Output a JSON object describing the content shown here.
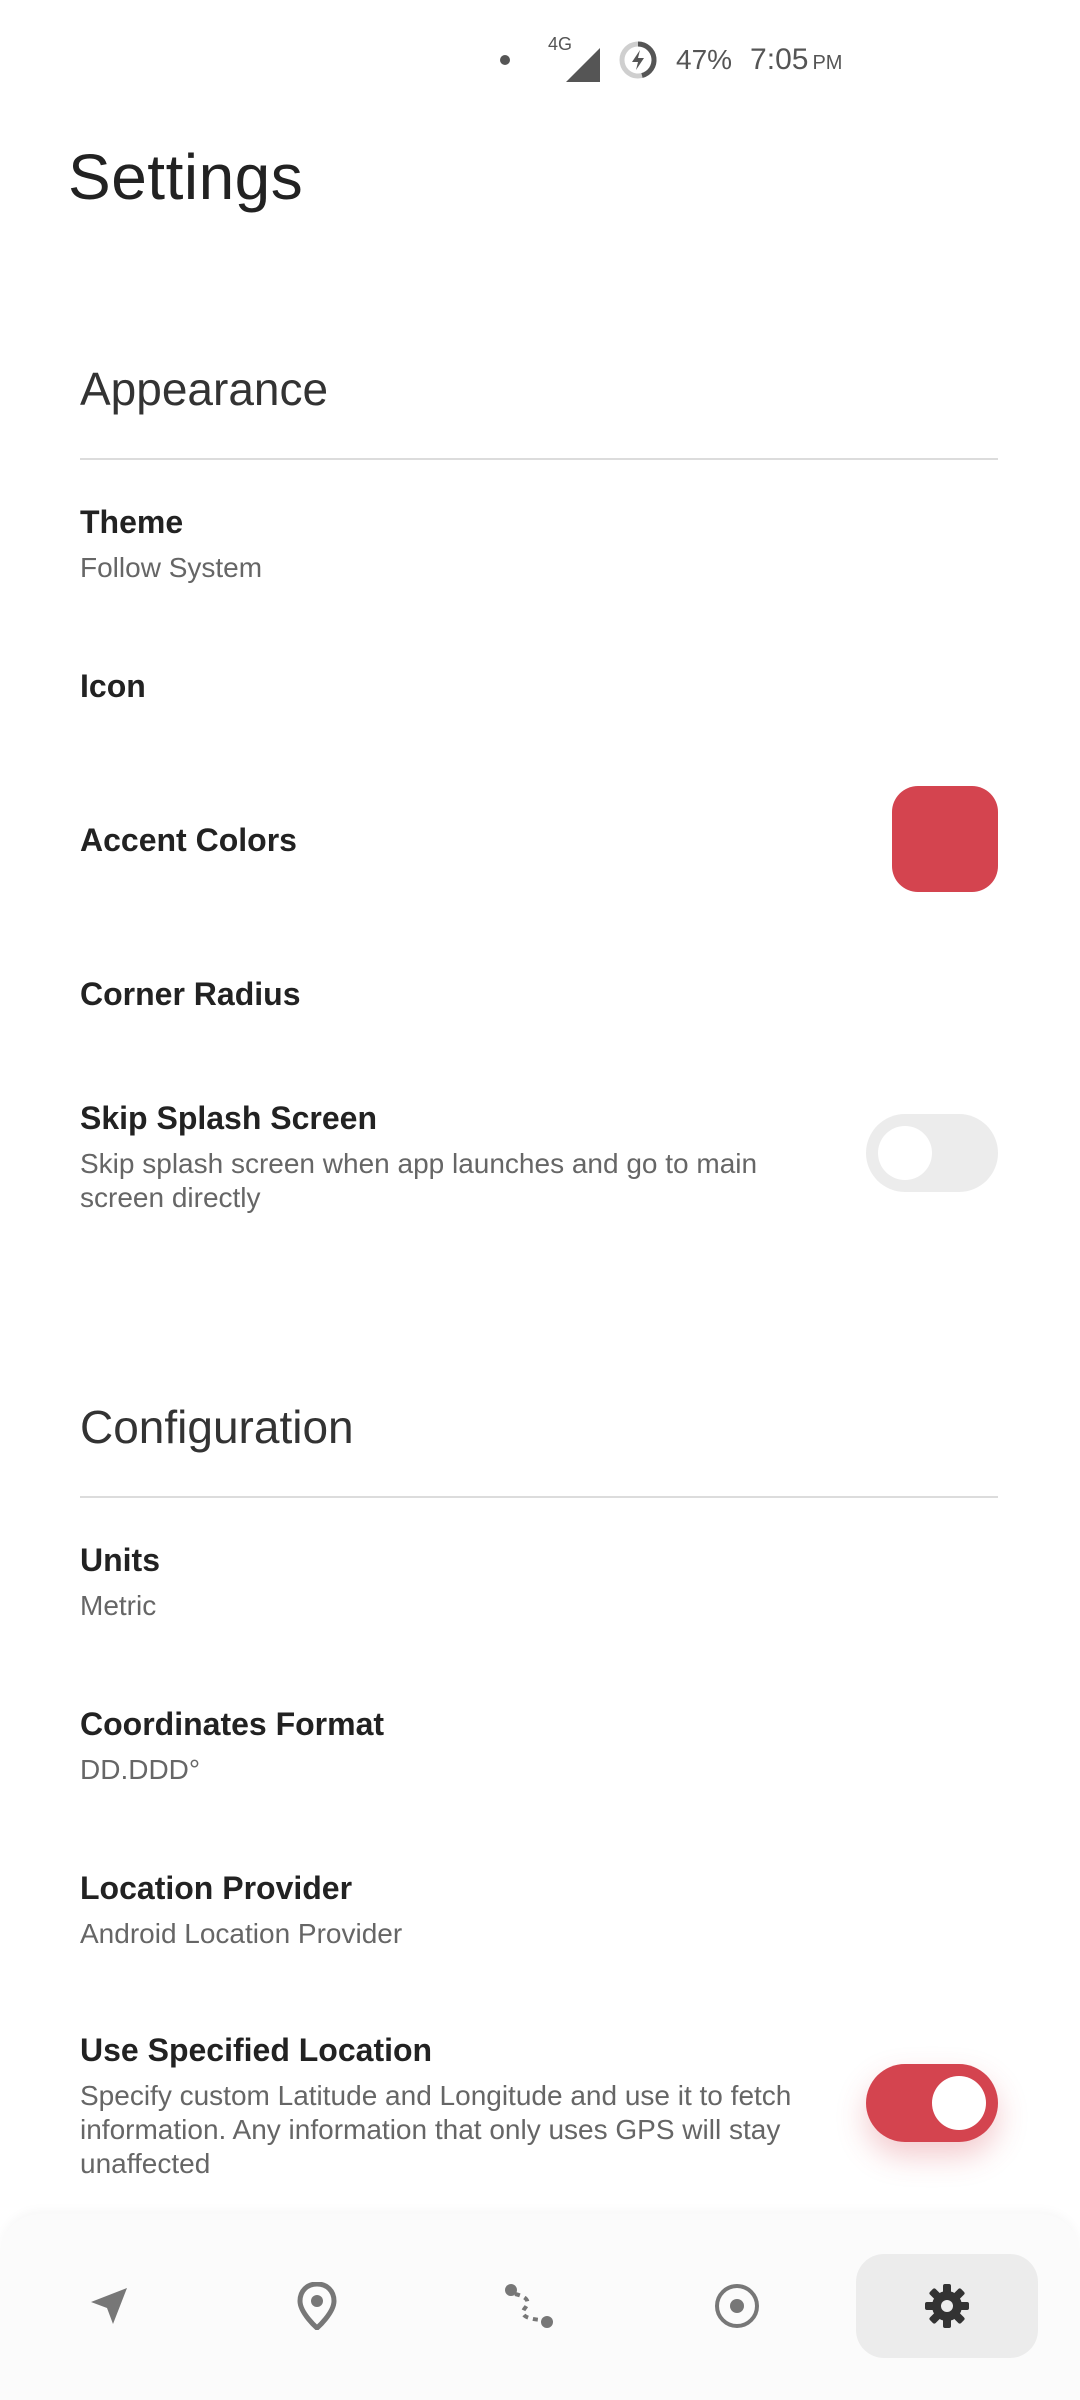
{
  "status_bar": {
    "network": "4G",
    "battery": "47%",
    "time": "7:05",
    "ampm": "PM"
  },
  "page": {
    "title": "Settings"
  },
  "appearance": {
    "title": "Appearance",
    "theme": {
      "title": "Theme",
      "summary": "Follow System"
    },
    "icon": {
      "title": "Icon"
    },
    "accent": {
      "title": "Accent Colors",
      "color": "#d4444f"
    },
    "corner_radius": {
      "title": "Corner Radius"
    },
    "skip_splash": {
      "title": "Skip Splash Screen",
      "summary": "Skip splash screen when app launches and go to main screen directly",
      "enabled": false
    }
  },
  "configuration": {
    "title": "Configuration",
    "units": {
      "title": "Units",
      "summary": "Metric"
    },
    "coordinates": {
      "title": "Coordinates Format",
      "summary": "DD.DDD°"
    },
    "location_provider": {
      "title": "Location Provider",
      "summary": "Android Location Provider"
    },
    "specified_location": {
      "title": "Use Specified Location",
      "summary": "Specify custom Latitude and Longitude and use it to fetch information. Any information that only uses GPS will stay unaffected",
      "enabled": true
    }
  },
  "bottom_nav": {
    "items": [
      {
        "icon": "navigation-arrow-icon",
        "active": false
      },
      {
        "icon": "location-pin-icon",
        "active": false
      },
      {
        "icon": "route-icon",
        "active": false
      },
      {
        "icon": "target-icon",
        "active": false
      },
      {
        "icon": "gear-icon",
        "active": true
      }
    ]
  },
  "colors": {
    "accent": "#d4444f",
    "toggle_off": "#ececec",
    "divider": "#dcdcdc"
  }
}
